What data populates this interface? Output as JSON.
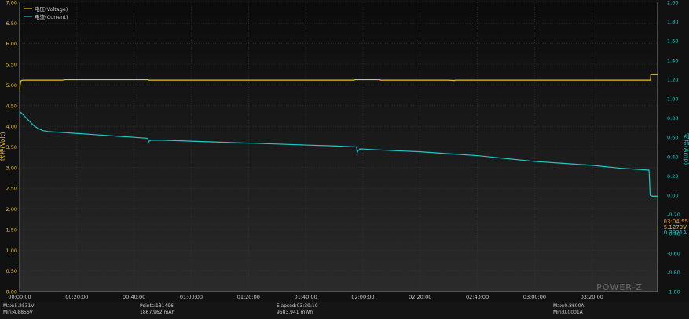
{
  "chart_data": {
    "type": "line",
    "legend": [
      {
        "label": "电压(Voltage)",
        "color": "#e8c21a"
      },
      {
        "label": "电流(Current)",
        "color": "#1ec8c8"
      }
    ],
    "legend_position": "top-left",
    "y_left": {
      "label": "伏特(Volt)",
      "range": [
        0,
        7
      ],
      "ticks": [
        "0.00",
        "0.50",
        "1.00",
        "1.50",
        "2.00",
        "2.50",
        "3.00",
        "3.50",
        "4.00",
        "4.50",
        "5.00",
        "5.50",
        "6.00",
        "6.50",
        "7.00"
      ],
      "color": "#e8c21a"
    },
    "y_right": {
      "label": "安培(Amp)",
      "range": [
        -1,
        2
      ],
      "ticks": [
        "-1.00",
        "-0.80",
        "-0.60",
        "-0.40",
        "-0.20",
        "0.00",
        "0.20",
        "0.40",
        "0.60",
        "0.80",
        "1.00",
        "1.20",
        "1.40",
        "1.60",
        "1.80",
        "2.00"
      ],
      "color": "#1ec8c8"
    },
    "x_axis": {
      "range_minutes": [
        0,
        223
      ],
      "tick_minutes": [
        0,
        20,
        40,
        60,
        80,
        100,
        120,
        140,
        160,
        180,
        200
      ],
      "tick_labels": [
        "00:00:00",
        "00:20:00",
        "00:40:00",
        "01:00:00",
        "01:20:00",
        "01:40:00",
        "02:00:00",
        "02:20:00",
        "02:40:00",
        "03:00:00",
        "03:20:00"
      ]
    },
    "grid": true,
    "series": [
      {
        "name": "电压(Voltage)",
        "axis": "left",
        "color": "#e8c21a",
        "x": [
          0,
          0.4,
          1,
          15,
          16,
          45,
          45.1,
          60,
          80,
          100,
          117,
          117.1,
          120,
          126,
          126.1,
          150,
          152,
          152.2,
          170,
          200,
          220.5,
          220.6,
          223
        ],
        "y": [
          4.89,
          5.1,
          5.12,
          5.12,
          5.13,
          5.13,
          5.12,
          5.12,
          5.12,
          5.12,
          5.12,
          5.13,
          5.13,
          5.13,
          5.12,
          5.12,
          5.11,
          5.12,
          5.12,
          5.12,
          5.12,
          5.25,
          5.25
        ]
      },
      {
        "name": "电流(Current)",
        "axis": "right",
        "color": "#1ec8c8",
        "x": [
          0,
          0.3,
          1,
          2,
          3,
          4,
          5,
          6,
          8,
          10,
          15,
          20,
          30,
          35,
          40,
          44.8,
          45,
          45.3,
          46,
          50,
          60,
          70,
          80,
          90,
          100,
          110,
          117.8,
          118,
          118.3,
          119,
          125,
          140,
          150,
          160,
          170,
          180,
          190,
          200,
          210,
          220,
          220.4,
          221,
          223
        ],
        "y": [
          0.84,
          0.86,
          0.84,
          0.81,
          0.78,
          0.75,
          0.72,
          0.7,
          0.67,
          0.66,
          0.65,
          0.64,
          0.62,
          0.61,
          0.6,
          0.59,
          0.55,
          0.56,
          0.57,
          0.57,
          0.56,
          0.55,
          0.54,
          0.53,
          0.52,
          0.51,
          0.5,
          0.44,
          0.46,
          0.48,
          0.47,
          0.45,
          0.43,
          0.41,
          0.38,
          0.35,
          0.33,
          0.31,
          0.28,
          0.26,
          0.0,
          -0.01,
          -0.01
        ]
      }
    ],
    "cursor": {
      "time": "03:04:55",
      "voltage": "5.1279V",
      "current": "0.3921A"
    },
    "watermark": "POWER-Z"
  },
  "stats": {
    "max_v": "Max:5.2531V",
    "min_v": "Min:4.8856V",
    "points": "Points:131496",
    "mah": "1867.962 mAh",
    "elapsed": "Elapsed:03:39:10",
    "mwh": "9583.941 mWh",
    "max_a": "Max:0.8600A",
    "min_a": "Min:0.0001A"
  }
}
